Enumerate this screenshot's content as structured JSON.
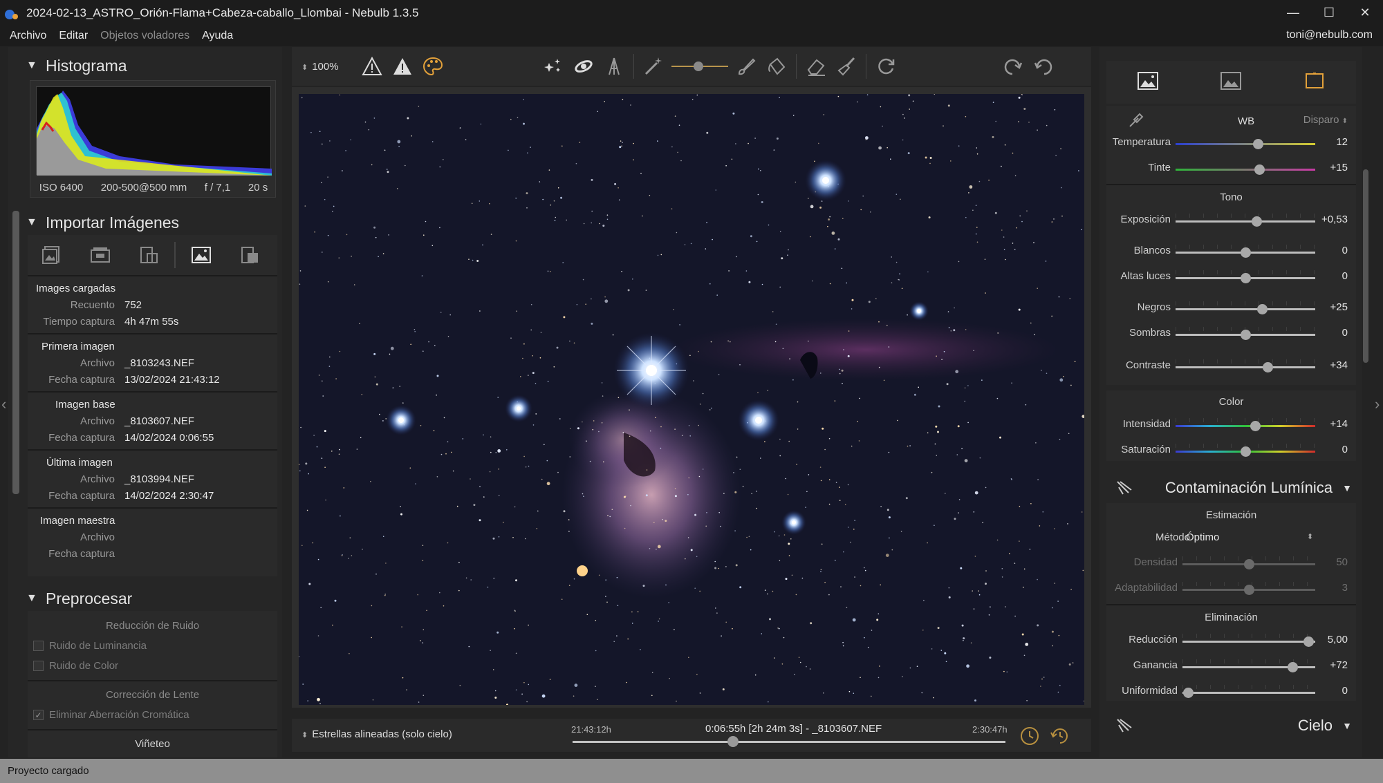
{
  "window": {
    "title": "2024-02-13_ASTRO_Orión-Flama+Cabeza-caballo_Llombai - Nebulb 1.3.5",
    "controls": {
      "minimize": "—",
      "maximize": "☐",
      "close": "✕"
    }
  },
  "menu": {
    "items": [
      "Archivo",
      "Editar",
      "Objetos voladores",
      "Ayuda"
    ],
    "user": "toni@nebulb.com"
  },
  "histogram": {
    "title": "Histograma",
    "iso": "ISO 6400",
    "lens": "200-500@500 mm",
    "aperture": "f / 7,1",
    "shutter": "20 s"
  },
  "import": {
    "title": "Importar Imágenes",
    "loaded": {
      "title": "Images cargadas",
      "count_label": "Recuento",
      "count": "752",
      "time_label": "Tiempo captura",
      "time": "4h 47m 55s"
    },
    "first": {
      "title": "Primera imagen",
      "file_label": "Archivo",
      "file": "_8103243.NEF",
      "date_label": "Fecha captura",
      "date": "13/02/2024 21:43:12"
    },
    "base": {
      "title": "Imagen base",
      "file_label": "Archivo",
      "file": "_8103607.NEF",
      "date_label": "Fecha captura",
      "date": "14/02/2024 0:06:55"
    },
    "last": {
      "title": "Última imagen",
      "file_label": "Archivo",
      "file": "_8103994.NEF",
      "date_label": "Fecha captura",
      "date": "14/02/2024 2:30:47"
    },
    "master": {
      "title": "Imagen maestra",
      "file_label": "Archivo",
      "date_label": "Fecha captura"
    }
  },
  "preprocess": {
    "title": "Preprocesar",
    "noise_title": "Reducción de Ruido",
    "luminance": "Ruido de Luminancia",
    "color": "Ruido de Color",
    "lens_title": "Corrección de Lente",
    "chromatic": "Eliminar Aberración Cromática",
    "vignette": "Viñeteo"
  },
  "toolbar": {
    "zoom": "100%"
  },
  "timeline": {
    "mode": "Estrellas alineadas (solo cielo)",
    "start": "21:43:12h",
    "end": "2:30:47h",
    "current": "0:06:55h [2h 24m 3s] - _8103607.NEF",
    "position": 0.37
  },
  "adjust": {
    "wb": {
      "label": "WB",
      "preset": "Disparo"
    },
    "temperature": {
      "label": "Temperatura",
      "value": "12",
      "pos": 0.59
    },
    "tint": {
      "label": "Tinte",
      "value": "+15",
      "pos": 0.6
    },
    "tone_title": "Tono",
    "exposure": {
      "label": "Exposición",
      "value": "+0,53",
      "pos": 0.58
    },
    "whites": {
      "label": "Blancos",
      "value": "0",
      "pos": 0.5
    },
    "highlights": {
      "label": "Altas luces",
      "value": "0",
      "pos": 0.5
    },
    "blacks": {
      "label": "Negros",
      "value": "+25",
      "pos": 0.62
    },
    "shadows": {
      "label": "Sombras",
      "value": "0",
      "pos": 0.5
    },
    "contrast": {
      "label": "Contraste",
      "value": "+34",
      "pos": 0.66
    },
    "color_title": "Color",
    "intensity": {
      "label": "Intensidad",
      "value": "+14",
      "pos": 0.57
    },
    "saturation": {
      "label": "Saturación",
      "value": "0",
      "pos": 0.5
    }
  },
  "light_pollution": {
    "title": "Contaminación Lumínica",
    "estimation_title": "Estimación",
    "method_label": "Método",
    "method": "Óptimo",
    "density": {
      "label": "Densidad",
      "value": "50",
      "pos": 0.5
    },
    "adaptability": {
      "label": "Adaptabilidad",
      "value": "3",
      "pos": 0.5
    },
    "elimination_title": "Eliminación",
    "reduction": {
      "label": "Reducción",
      "value": "5,00",
      "pos": 0.95
    },
    "gain": {
      "label": "Ganancia",
      "value": "+72",
      "pos": 0.83
    },
    "uniformity": {
      "label": "Uniformidad",
      "value": "0",
      "pos": 0.04
    }
  },
  "sky": {
    "title": "Cielo"
  },
  "status": "Proyecto cargado"
}
